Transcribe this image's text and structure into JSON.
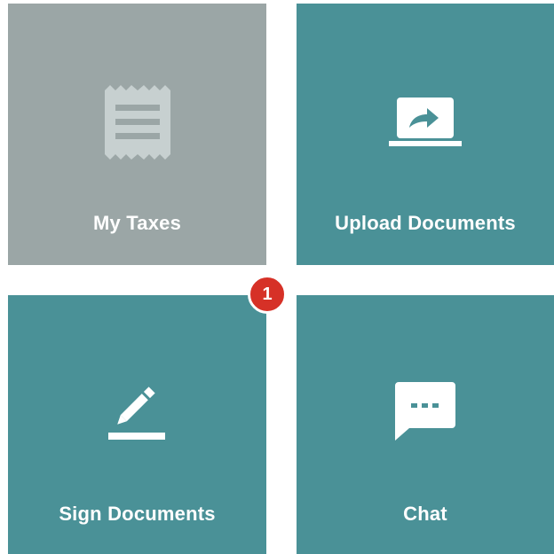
{
  "tiles": {
    "my_taxes": {
      "label": "My Taxes",
      "icon": "receipt-icon",
      "color": "#9ba6a6"
    },
    "upload_documents": {
      "label": "Upload Documents",
      "icon": "laptop-share-icon",
      "color": "#4a9197"
    },
    "sign_documents": {
      "label": "Sign Documents",
      "icon": "pencil-sign-icon",
      "color": "#4a9197",
      "badge_count": "1"
    },
    "chat": {
      "label": "Chat",
      "icon": "chat-bubble-icon",
      "color": "#4a9197"
    }
  },
  "colors": {
    "badge": "#d63127",
    "icon_light": "#ffffff",
    "icon_muted": "#c7d0d0"
  }
}
